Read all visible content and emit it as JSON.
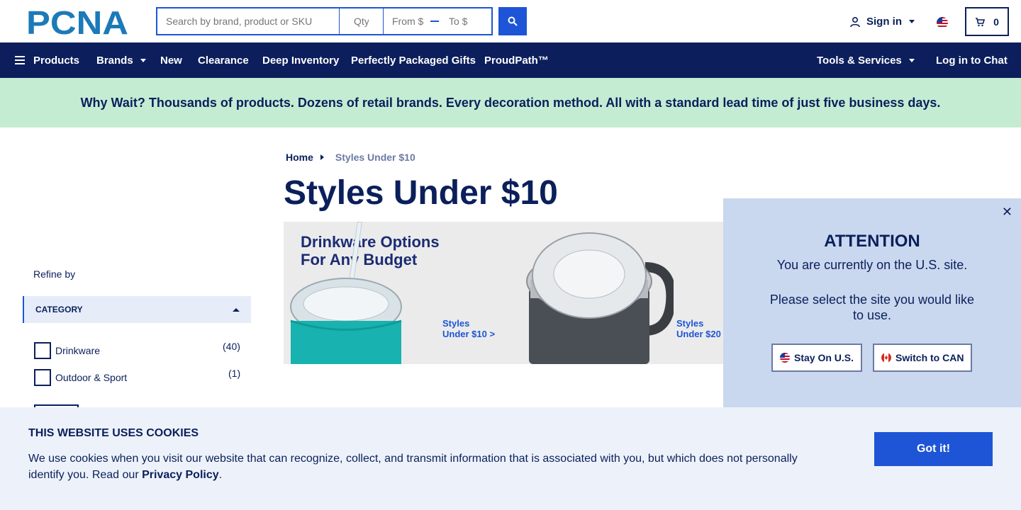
{
  "header": {
    "logo_text": "PCNA",
    "search_placeholder": "Search by brand, product or SKU",
    "qty_placeholder": "Qty",
    "price_from_placeholder": "From $",
    "price_to_placeholder": "To $",
    "signin_label": "Sign in",
    "cart_count": "0"
  },
  "nav": {
    "items": [
      {
        "label": "Products"
      },
      {
        "label": "Brands"
      },
      {
        "label": "New"
      },
      {
        "label": "Clearance"
      },
      {
        "label": "Deep Inventory"
      },
      {
        "label": "Perfectly Packaged Gifts"
      },
      {
        "label": "ProudPath™"
      }
    ],
    "tools_label": "Tools & Services",
    "chat_label": "Log in to Chat"
  },
  "banner": {
    "text": "Why Wait? Thousands of products. Dozens of retail brands. Every decoration method. All with a standard lead time of just five business days."
  },
  "sidebar": {
    "refine_label": "Refine by",
    "category_label": "CATEGORY",
    "filters": [
      {
        "label": "Drinkware",
        "count": "(40)"
      },
      {
        "label": "Outdoor & Sport",
        "count": "(1)"
      }
    ]
  },
  "breadcrumb": {
    "home": "Home",
    "current": "Styles Under $10"
  },
  "page": {
    "title": "Styles Under $10"
  },
  "hero": {
    "title_line1": "Drinkware Options",
    "title_line2": "For Any Budget",
    "link1_line1": "Styles",
    "link1_line2": "Under $10 >",
    "link2_line1": "Styles",
    "link2_line2": "Under $20"
  },
  "modal": {
    "title": "ATTENTION",
    "message": "You are currently on the U.S. site.",
    "prompt": "Please select the site you would like to use.",
    "stay_label": "Stay On U.S.",
    "switch_label": "Switch to CAN"
  },
  "cookie": {
    "title": "THIS WEBSITE USES COOKIES",
    "text": "We use cookies when you visit our website that can recognize, collect, and transmit information that is associated with you, but which does not personally identify you. Read our",
    "link": "Privacy Policy",
    "end": ".",
    "button": "Got it!"
  },
  "colors": {
    "navy": "#0c1e5c",
    "accent": "#1d55d6",
    "banner": "#c4ecd3",
    "modal": "#c9d8ef"
  }
}
